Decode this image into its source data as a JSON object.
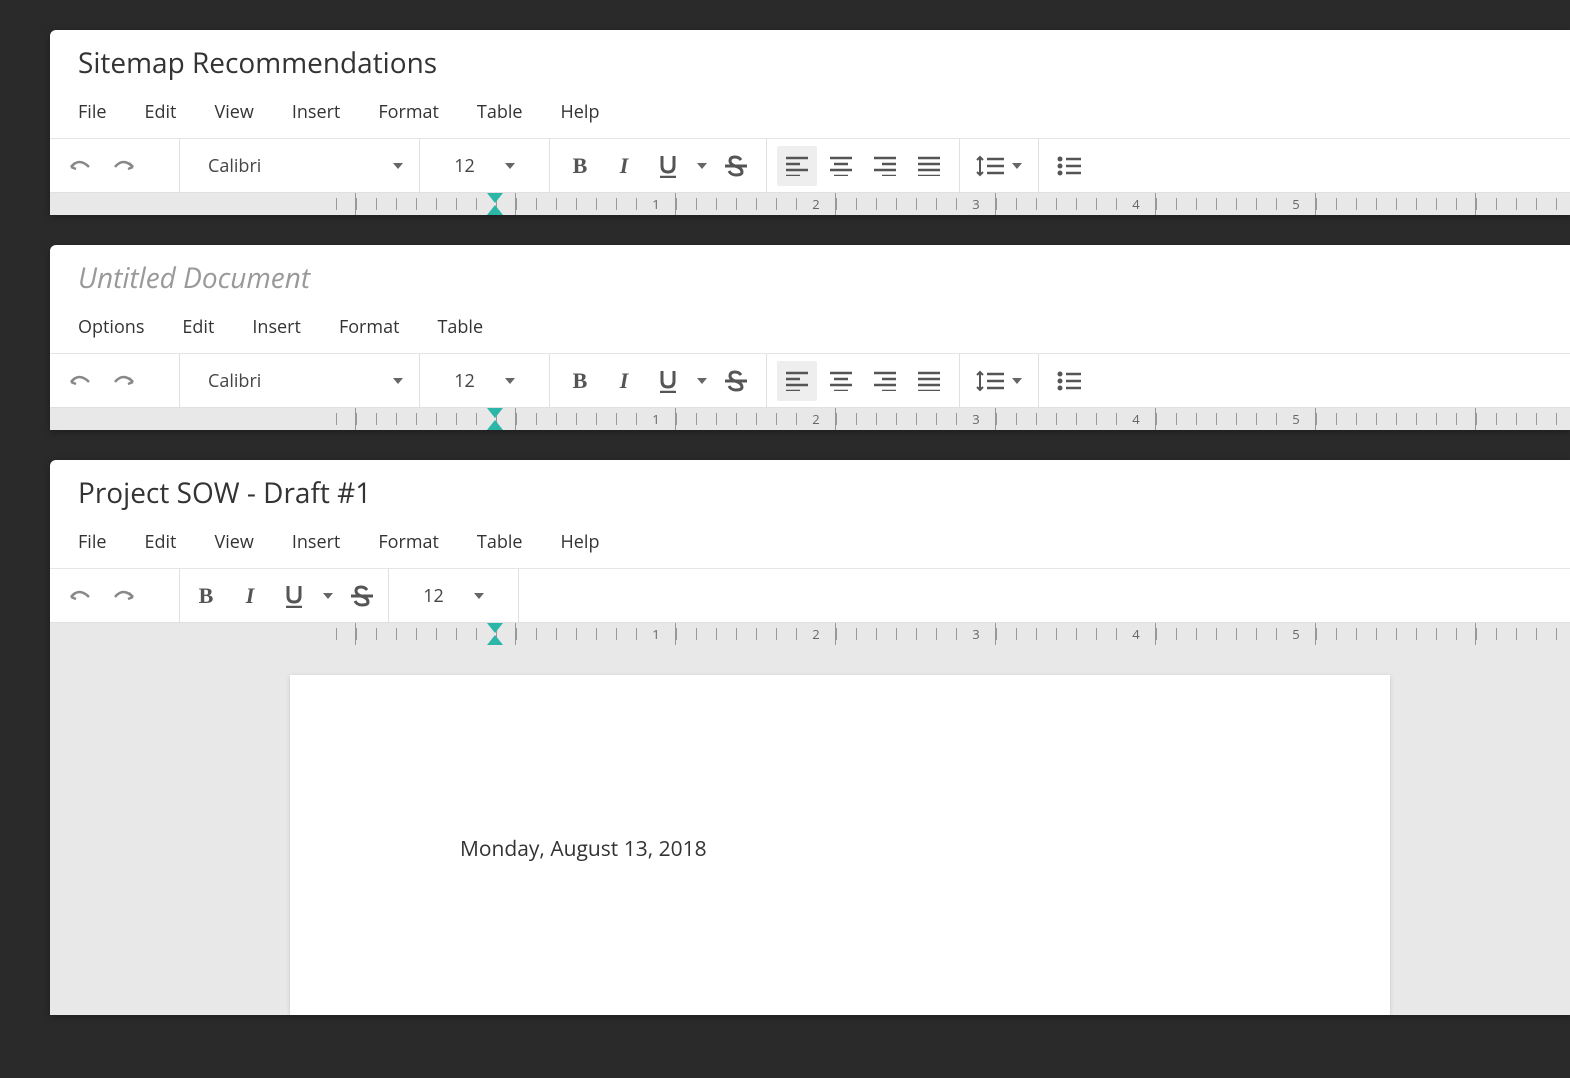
{
  "editors": [
    {
      "title": "Sitemap Recommendations",
      "title_placeholder": false,
      "menus": [
        "File",
        "Edit",
        "View",
        "Insert",
        "Format",
        "Table",
        "Help"
      ],
      "font": "Calibri",
      "size": "12",
      "toolbar_layout": "full",
      "ruler_numbers": [
        "1",
        "2",
        "3",
        "4",
        "5"
      ]
    },
    {
      "title": "Untitled Document",
      "title_placeholder": true,
      "menus": [
        "Options",
        "Edit",
        "Insert",
        "Format",
        "Table"
      ],
      "font": "Calibri",
      "size": "12",
      "toolbar_layout": "full",
      "ruler_numbers": [
        "1",
        "2",
        "3",
        "4",
        "5"
      ]
    },
    {
      "title": "Project SOW - Draft #1",
      "title_placeholder": false,
      "menus": [
        "File",
        "Edit",
        "View",
        "Insert",
        "Format",
        "Table",
        "Help"
      ],
      "font": "",
      "size": "12",
      "toolbar_layout": "compact",
      "ruler_numbers": [
        "1",
        "2",
        "3",
        "4",
        "5"
      ],
      "document_body": "Monday, August 13, 2018"
    }
  ]
}
